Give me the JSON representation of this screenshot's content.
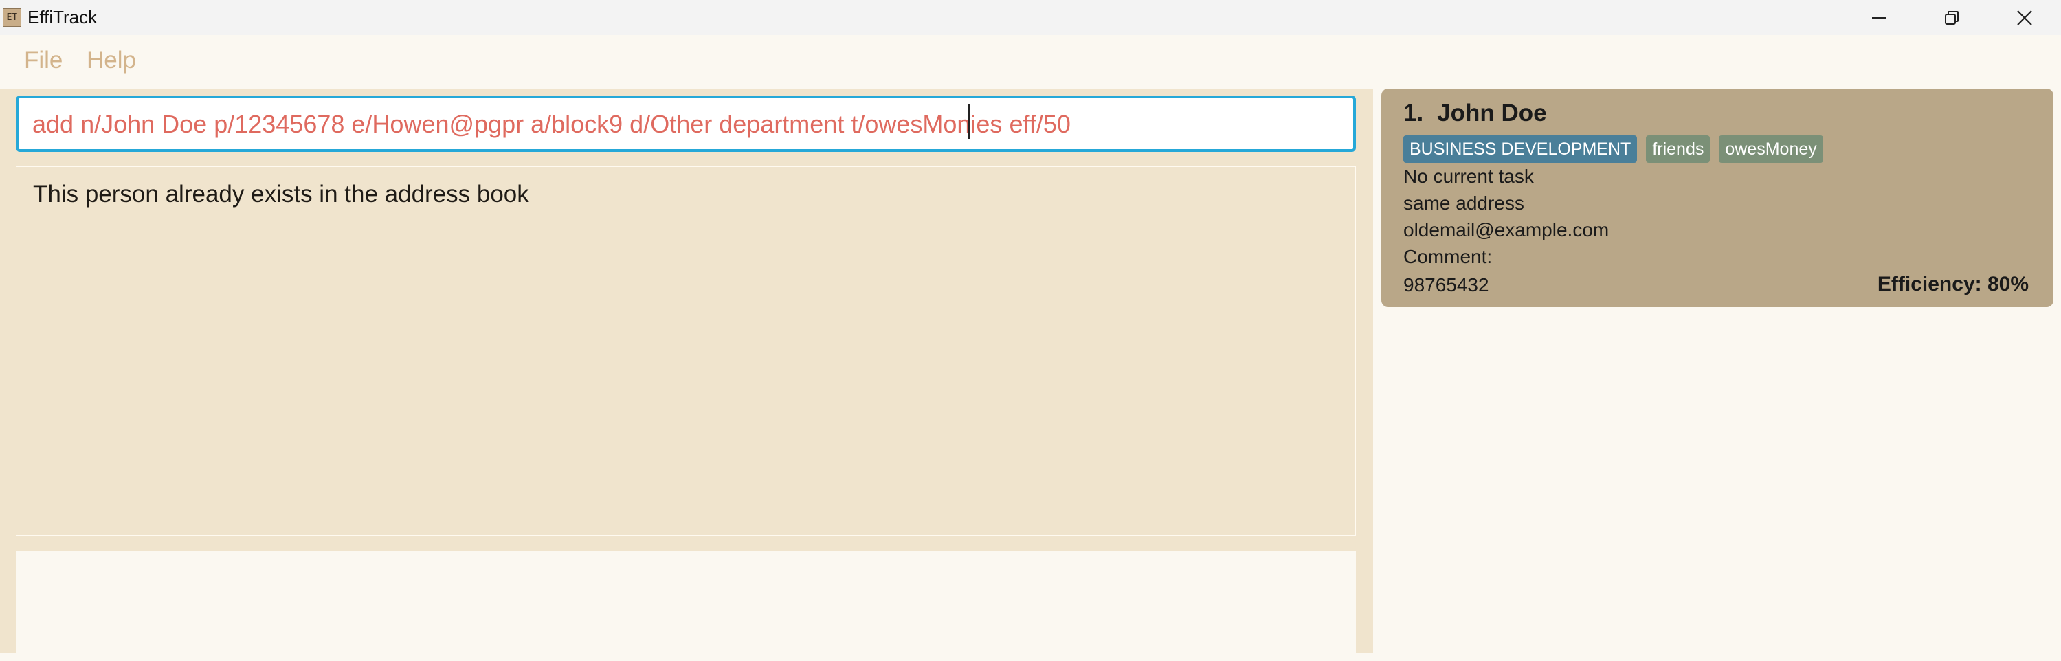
{
  "window": {
    "icon_glyph": "ET",
    "title": "EffiTrack",
    "controls": [
      "minimize-icon",
      "maximize-icon",
      "close-icon"
    ]
  },
  "menu": {
    "file_label": "File",
    "help_label": "Help"
  },
  "command": {
    "value": "add n/John Doe p/12345678 e/Howen@pgpr a/block9 d/Other department t/owesMonies eff/50"
  },
  "result": {
    "message": "This person already exists in the address book"
  },
  "status": {
    "text": ""
  },
  "person_list": {
    "items": [
      {
        "index": "1.",
        "name": "John Doe",
        "tags": [
          "BUSINESS DEVELOPMENT",
          "friends",
          "owesMoney"
        ],
        "task": "No current task",
        "address": "same address",
        "email": "oldemail@example.com",
        "comment": "Comment:",
        "phone": "98765432",
        "efficiency": "Efficiency: 80%"
      }
    ]
  },
  "colors": {
    "accent_border": "#26a8d8",
    "command_text": "#df6a5f",
    "card_bg": "#b9a788",
    "department_tag": "#4a7f99",
    "tag": "#7b9077",
    "panel_bg": "#f0e4cd",
    "menu_text": "#d3b48c"
  }
}
